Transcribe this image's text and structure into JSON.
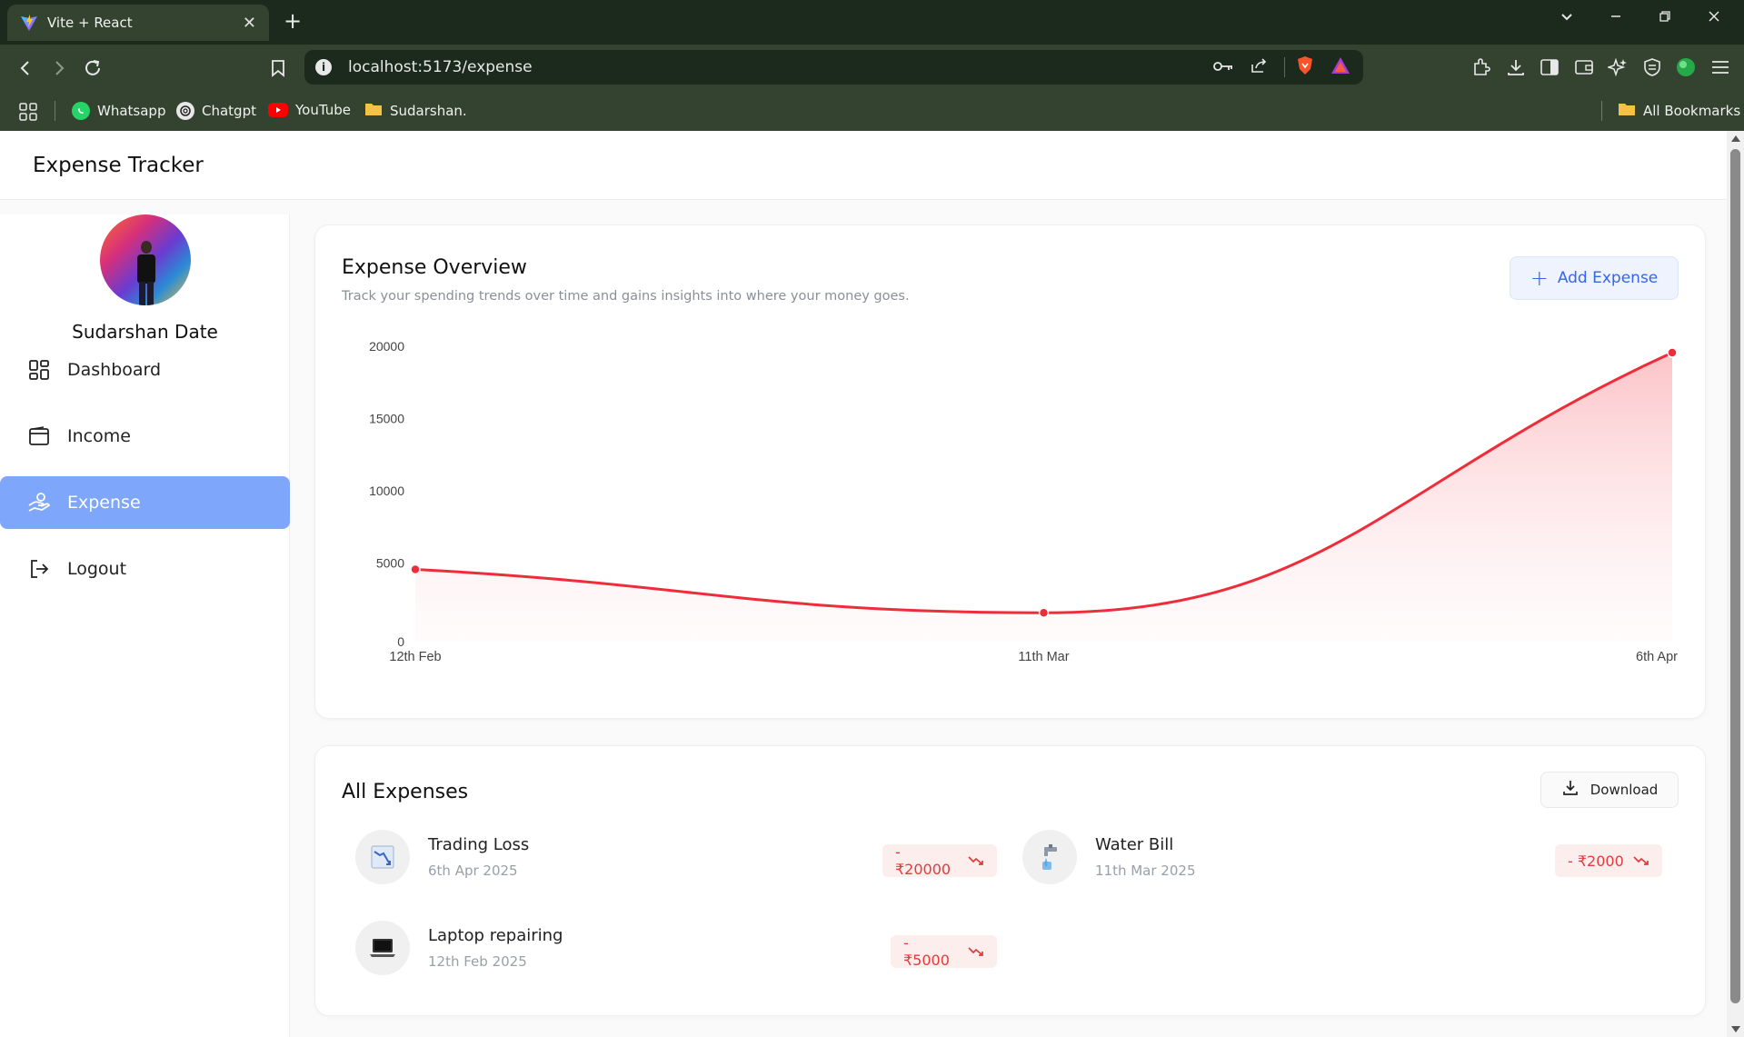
{
  "browser": {
    "tab_title": "Vite + React",
    "url_host": "localhost",
    "url_rest": ":5173/expense",
    "bookmarks": [
      {
        "label": "Whatsapp",
        "icon": "whatsapp-icon"
      },
      {
        "label": "Chatgpt",
        "icon": "chatgpt-icon"
      },
      {
        "label": "YouTube",
        "icon": "youtube-icon"
      },
      {
        "label": "Sudarshan.",
        "icon": "folder-icon"
      }
    ],
    "all_bookmarks": "All Bookmarks"
  },
  "app": {
    "title": "Expense Tracker"
  },
  "sidebar": {
    "profile_name": "Sudarshan Date",
    "items": [
      {
        "label": "Dashboard",
        "icon": "dashboard-icon",
        "active": false
      },
      {
        "label": "Income",
        "icon": "wallet-icon",
        "active": false
      },
      {
        "label": "Expense",
        "icon": "hand-money-icon",
        "active": true
      },
      {
        "label": "Logout",
        "icon": "logout-icon",
        "active": false
      }
    ]
  },
  "overview": {
    "title": "Expense Overview",
    "subtitle": "Track your spending trends over time and gains insights into where your money goes.",
    "add_button": "Add Expense"
  },
  "chart_data": {
    "type": "area",
    "categories": [
      "12th Feb",
      "11th Mar",
      "6th Apr"
    ],
    "values": [
      5000,
      2000,
      20000
    ],
    "y_ticks": [
      "0",
      "5000",
      "10000",
      "15000",
      "20000"
    ],
    "ylim": [
      0,
      20000
    ],
    "grid": false,
    "line_color": "#ef2d3a",
    "fill_color": "#fcc6c9"
  },
  "expenses": {
    "title": "All Expenses",
    "download_label": "Download",
    "items": [
      {
        "name": "Trading Loss",
        "date": "6th Apr 2025",
        "amount": "- ₹20000",
        "icon": "chart-down-icon"
      },
      {
        "name": "Water Bill",
        "date": "11th Mar 2025",
        "amount": "- ₹2000",
        "icon": "faucet-icon"
      },
      {
        "name": "Laptop repairing",
        "date": "12th Feb 2025",
        "amount": "- ₹5000",
        "icon": "laptop-icon"
      }
    ]
  },
  "colors": {
    "accent": "#3566e8",
    "active_nav": "#7ea6fb",
    "expense_red": "#e23b3b"
  }
}
